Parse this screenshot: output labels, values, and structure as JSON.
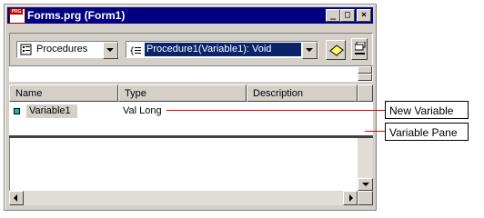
{
  "window": {
    "title": "Forms.prg (Form1)",
    "app_icon_text": "PRG",
    "buttons": {
      "minimize": "_",
      "maximize": "□",
      "close": "×"
    }
  },
  "toolbar": {
    "object_combo_value": "Procedures",
    "procedure_combo_value": "Procedure1(Variable1): Void"
  },
  "grid": {
    "columns": [
      "Name",
      "Type",
      "Description"
    ],
    "rows": [
      {
        "name": "Variable1",
        "type": "Val Long",
        "description": ""
      }
    ]
  },
  "callouts": {
    "new_variable": "New Variable",
    "variable_pane": "Variable Pane"
  },
  "colors": {
    "title_bar": "#000080",
    "selection": "#0a246a",
    "callout_line": "#e00000",
    "variable_marker": "#00c0c0"
  }
}
